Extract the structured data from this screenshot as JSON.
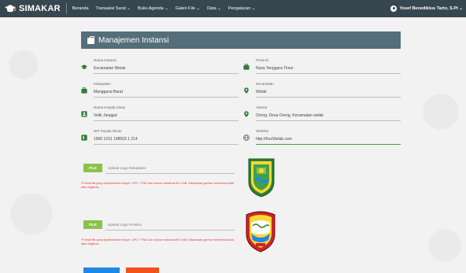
{
  "navbar": {
    "brand": "SIMAKAR",
    "items": [
      {
        "label": "Beranda"
      },
      {
        "label": "Transaksi Surat ⌄"
      },
      {
        "label": "Buku Agenda ⌄"
      },
      {
        "label": "Galeri File ⌄"
      },
      {
        "label": "Data ⌄"
      },
      {
        "label": "Pengaturan ⌄"
      }
    ],
    "user": "Yosef Benediktus Tarto, S.Pt ⌄"
  },
  "page": {
    "title": "Manajemen Instansi"
  },
  "fields": {
    "nama_instansi": {
      "label": "Nama Instansi",
      "value": "Kecamatan Welak"
    },
    "provinsi": {
      "label": "Provinsi",
      "value": "Nusa Tenggara Timur"
    },
    "kabupaten": {
      "label": "Kabupaten",
      "value": "Manggarai Barat"
    },
    "kecamatan": {
      "label": "Kecamatan",
      "value": "Welak"
    },
    "kepala_dinas": {
      "label": "Nama Kepala Dinas",
      "value": "Velik Janggut"
    },
    "alamat": {
      "label": "Alamat",
      "value": "Orong, Desa Orong, Kecamatan welak"
    },
    "nip": {
      "label": "NIP Kepala Dinas",
      "value": "1966 1231 198503 1 214"
    },
    "website": {
      "label": "Website",
      "value": "http://KecWelak.com"
    }
  },
  "uploads": {
    "kabupaten": {
      "button": "FILE",
      "placeholder": "Upload Logo Kabupaten",
      "note": "*Format file yang diperbolehkan hanya *.JPG, *.PNG dan ukuran maksimal file 2 MB. Disarankan gambar berbentuk kotak atau lingkaran"
    },
    "provinsi": {
      "button": "FILE",
      "placeholder": "Upload Logo Provinsi",
      "note": "*Format file yang diperbolehkan hanya *.JPG, *.PNG dan ukuran maksimal file 2 MB. Disarankan gambar berbentuk kotak atau lingkaran"
    }
  },
  "colors": {
    "navbar": "#37474f",
    "card_header": "#546e7a",
    "accent_green": "#8bc34a",
    "icon_green": "#2e7d32",
    "note_red": "#e53935",
    "save_button": "#1e88e5",
    "reset_button": "#f4511e"
  }
}
